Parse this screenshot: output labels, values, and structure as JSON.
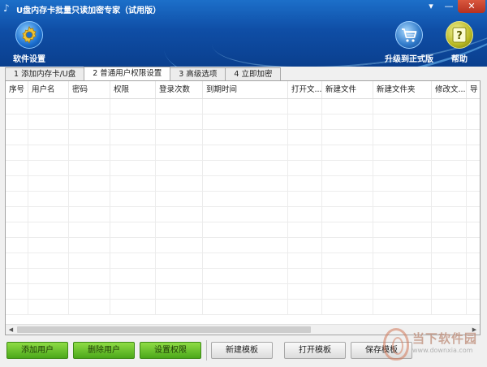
{
  "window": {
    "title": "U盘内存卡批量只读加密专家（试用版）",
    "controls": {
      "menu": "▾",
      "minimize": "—",
      "close": "✕"
    }
  },
  "toolbar": {
    "settings_label": "软件设置",
    "upgrade_label": "升级到正式版",
    "help_label": "帮助"
  },
  "tabs": [
    {
      "label": "1 添加内存卡/U盘",
      "active": false
    },
    {
      "label": "2 普通用户权限设置",
      "active": true
    },
    {
      "label": "3 高级选项",
      "active": false
    },
    {
      "label": "4 立即加密",
      "active": false
    }
  ],
  "table": {
    "columns": [
      "序号",
      "用户名",
      "密码",
      "权限",
      "登录次数",
      "到期时间",
      "打开文...",
      "新建文件",
      "新建文件夹",
      "修改文...",
      "导"
    ],
    "empty_rows": 14
  },
  "buttons": {
    "add_user": "添加用户",
    "delete_user": "删除用户",
    "set_permission": "设置权限",
    "new_template": "新建模板",
    "open_template": "打开模板",
    "save_template": "保存模板"
  },
  "watermark": {
    "brand": "当下软件园",
    "url": "www.downxia.com"
  },
  "colors": {
    "header_top": "#1c6fc9",
    "header_bottom": "#0a3f8e",
    "green_button": "#4ba81a"
  }
}
